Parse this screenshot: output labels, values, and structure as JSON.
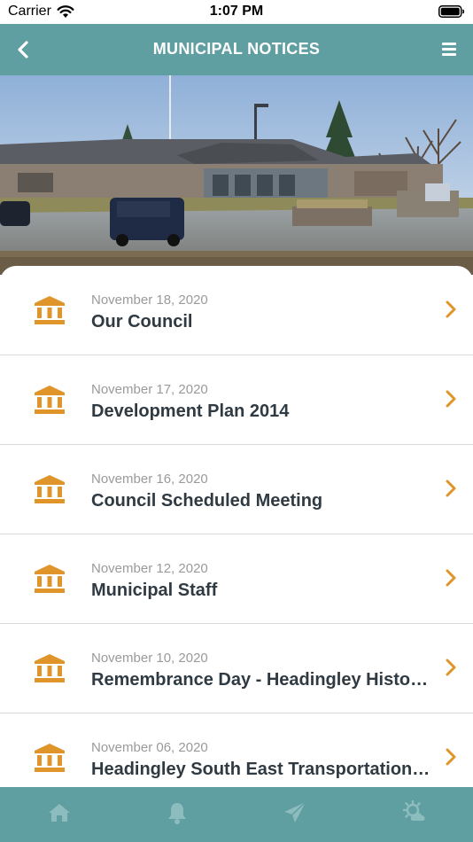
{
  "status_bar": {
    "carrier": "Carrier",
    "time": "1:07 PM"
  },
  "nav": {
    "title": "MUNICIPAL NOTICES",
    "back_icon": "chevron-left-icon",
    "menu_icon": "hamburger-menu-icon"
  },
  "colors": {
    "header": "#5f9ea1",
    "accent": "#e0952b",
    "date_text": "#9a9a9a",
    "title_text": "#2f3a42"
  },
  "notices": [
    {
      "date": "November 18, 2020",
      "title": "Our Council"
    },
    {
      "date": "November 17, 2020",
      "title": "Development Plan 2014"
    },
    {
      "date": "November 16, 2020",
      "title": "Council Scheduled Meeting"
    },
    {
      "date": "November 12, 2020",
      "title": "Municipal Staff"
    },
    {
      "date": "November 10, 2020",
      "title": "Remembrance Day - Headingley Historical Society"
    },
    {
      "date": "November 06, 2020",
      "title": "Headingley South East Transportation Study"
    }
  ],
  "tab_bar": {
    "tabs": [
      "home-icon",
      "bell-icon",
      "paper-plane-icon",
      "weather-icon"
    ]
  }
}
